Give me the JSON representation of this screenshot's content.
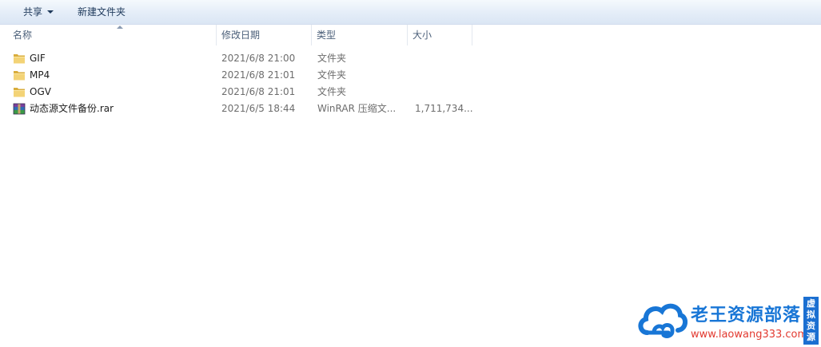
{
  "toolbar": {
    "share_label": "共享",
    "new_folder_label": "新建文件夹"
  },
  "columns": {
    "name": "名称",
    "date": "修改日期",
    "type": "类型",
    "size": "大小"
  },
  "files": [
    {
      "name": "GIF",
      "date": "2021/6/8 21:00",
      "type": "文件夹",
      "size": "",
      "icon": "folder-icon"
    },
    {
      "name": "MP4",
      "date": "2021/6/8 21:01",
      "type": "文件夹",
      "size": "",
      "icon": "folder-icon"
    },
    {
      "name": "OGV",
      "date": "2021/6/8 21:01",
      "type": "文件夹",
      "size": "",
      "icon": "folder-icon"
    },
    {
      "name": "动态源文件备份.rar",
      "date": "2021/6/5 18:44",
      "type": "WinRAR 压缩文...",
      "size": "1,711,734...",
      "icon": "rar-archive-icon"
    }
  ],
  "watermark": {
    "brand": "老王资源部落",
    "url": "www.laowang333.com",
    "badge": "虚拟资源"
  },
  "colors": {
    "toolbar_text": "#1e395b",
    "header_text": "#4c607a",
    "folder": "#e8c25a",
    "brand_blue": "#1876d6",
    "url_red": "#e23a30"
  }
}
